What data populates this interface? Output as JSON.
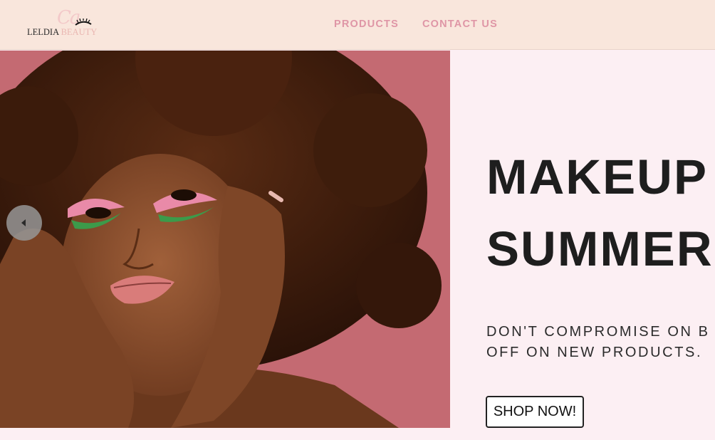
{
  "header": {
    "logo": {
      "script": "Ca",
      "name": "LELDIA",
      "suffix": "BEAUTY"
    },
    "nav": [
      {
        "label": "PRODUCTS"
      },
      {
        "label": "CONTACT US"
      }
    ]
  },
  "hero": {
    "headline_line1": "MAKEUP",
    "headline_line2": "SUMMER",
    "subtext_line1": "DON'T COMPROMISE ON B",
    "subtext_line2": "OFF ON NEW PRODUCTS.",
    "cta_label": "SHOP NOW!",
    "image_alt": "model-with-afro-and-pink-green-eyeshadow",
    "prev_icon": "chevron-left-icon"
  },
  "colors": {
    "header_bg": "#f9e6dc",
    "nav_text": "#df96a6",
    "page_bg": "#fceff3",
    "image_bg": "#c46a72",
    "headline": "#1e1e1e"
  }
}
